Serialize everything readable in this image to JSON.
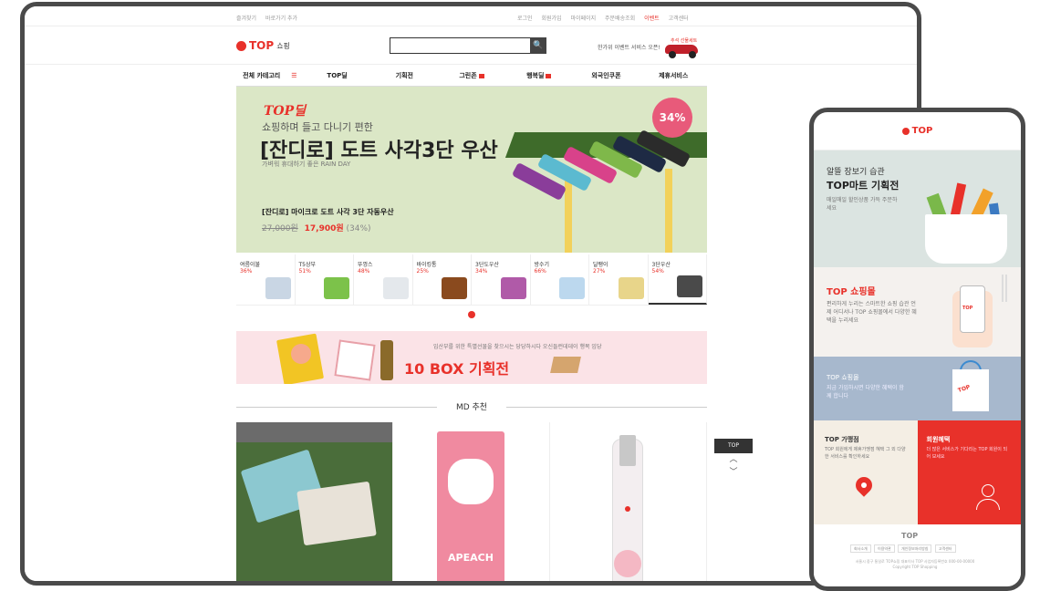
{
  "desktop": {
    "topbar": {
      "left_links": [
        "즐겨찾기",
        "바로가기 추가"
      ],
      "right_links": [
        "로그인",
        "회원가입",
        "마이페이지",
        "주문배송조회",
        "이벤트",
        "고객센터"
      ]
    },
    "header": {
      "logo_text": "TOP",
      "logo_sub": "쇼핑",
      "search_placeholder": "",
      "search_button": "🔍",
      "promo_text": "한가위 이벤트 서비스 오픈!",
      "promo_tag": "추석 선물세트"
    },
    "gnb": {
      "items": [
        "전체 카테고리",
        "TOP딜",
        "기획전",
        "그린존",
        "행복딜",
        "외국인쿠폰",
        "제휴서비스"
      ]
    },
    "hero": {
      "brand": "TOP딜",
      "line1": "쇼핑하며 들고 다니기 편한",
      "title": "[잔디로] 도트 사각3단 우산",
      "line3": "가벼워 휴대하기 좋은 RAIN DAY",
      "product": "[잔디로] 마이크로 도트 사각 3단 자동우산",
      "old_price": "27,000원",
      "new_price": "17,900원",
      "discount_note": "(34%)",
      "badge": "34%"
    },
    "thumbs": [
      {
        "label": "여름이불",
        "pct": "36%"
      },
      {
        "label": "T5상부",
        "pct": "51%"
      },
      {
        "label": "뚜껑스",
        "pct": "48%"
      },
      {
        "label": "바이킹통",
        "pct": "25%"
      },
      {
        "label": "3단도우산",
        "pct": "34%"
      },
      {
        "label": "방수기",
        "pct": "66%"
      },
      {
        "label": "달팽이",
        "pct": "27%"
      },
      {
        "label": "3단우산",
        "pct": "54%"
      }
    ],
    "box_banner": {
      "small": "입산부를 위한 특별선물을 찾으시는 당당하시다 오신들런데데이 행복 임당",
      "big": "10 BOX 기획전"
    },
    "section_title": "MD 추천",
    "md_cards": [
      {
        "name": "towel-set"
      },
      {
        "name": "apeach-towel",
        "word": "APEACH"
      },
      {
        "name": "cosmetic-bottle"
      }
    ],
    "side": {
      "top": "TOP",
      "up": "︿",
      "down": "﹀"
    }
  },
  "mobile": {
    "header_logo": "TOP",
    "s1": {
      "t1": "알뜰 장보기 습관",
      "t2": "TOP마트 기획전",
      "t3": "매일매일 할인상품 가득 주문하세요"
    },
    "s2": {
      "t1": "TOP 쇼핑몰",
      "t2": "편리하게 누리는 스마트한 쇼핑 습관 언제 어디서나 TOP 쇼핑몰에서 다양한 혜택을 누리세요",
      "mini": "TOP"
    },
    "s3": {
      "t1": "TOP 쇼핑몰",
      "t2": "지금 가입하시면 다양한 혜택이 함께 합니다",
      "shop_logo": "TOP"
    },
    "s4": {
      "t1": "TOP 가맹점",
      "t2": "TOP 회원에게 제휴가맹점 혜택 그 외 다양한 서비스를 확인하세요"
    },
    "s5": {
      "t1": "회원혜택",
      "t2": "더 많은 서비스가 기다리는 TOP 회원이 되어 보세요"
    },
    "footer": {
      "logo": "TOP",
      "links": [
        "회사소개",
        "이용약관",
        "개인정보처리방침",
        "고객센터"
      ],
      "copy": "서울시 중구 통일로 TOP쇼핑 대표이사 TOP  사업자등록번호 000-00-00000  Copyright TOP Shopping"
    }
  },
  "colors": {
    "accent": "#e8312a",
    "frame": "#4a4a4a"
  }
}
